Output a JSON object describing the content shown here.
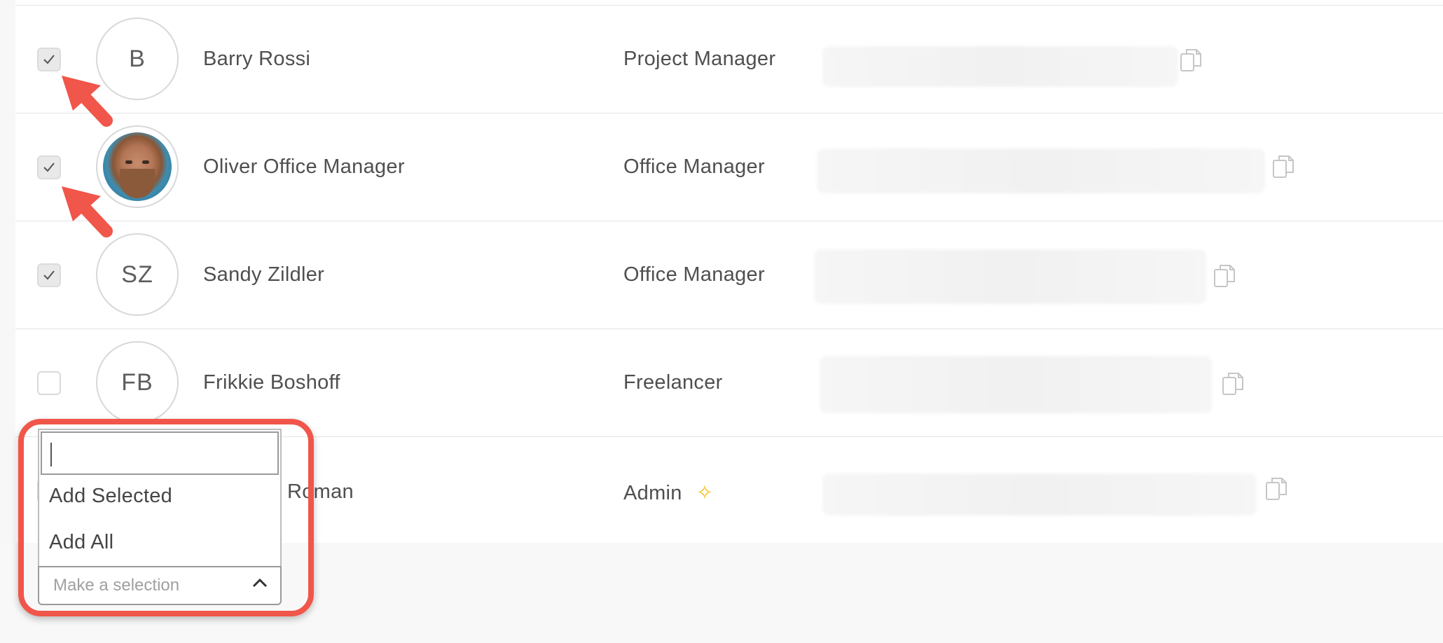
{
  "rows": [
    {
      "checked": true,
      "initials": "B",
      "name": "Barry Rossi",
      "role": "Project Manager"
    },
    {
      "checked": true,
      "initials": "",
      "name": "Oliver Office Manager",
      "role": "Office Manager",
      "avatar": "photo"
    },
    {
      "checked": true,
      "initials": "SZ",
      "name": "Sandy Zildler",
      "role": "Office Manager"
    },
    {
      "checked": false,
      "initials": "FB",
      "name": "Frikkie Boshoff",
      "role": "Freelancer"
    },
    {
      "checked": false,
      "initials": "",
      "name": "Roman",
      "role": "Admin",
      "role_icon": "sparkle-star-icon"
    }
  ],
  "dropdown": {
    "search_value": "",
    "items": [
      "Add Selected",
      "Add All"
    ],
    "select_placeholder": "Make a selection"
  },
  "colors": {
    "annotation": "#f0564a",
    "star": "#f2c21b",
    "row_border": "#e4e4e4"
  }
}
